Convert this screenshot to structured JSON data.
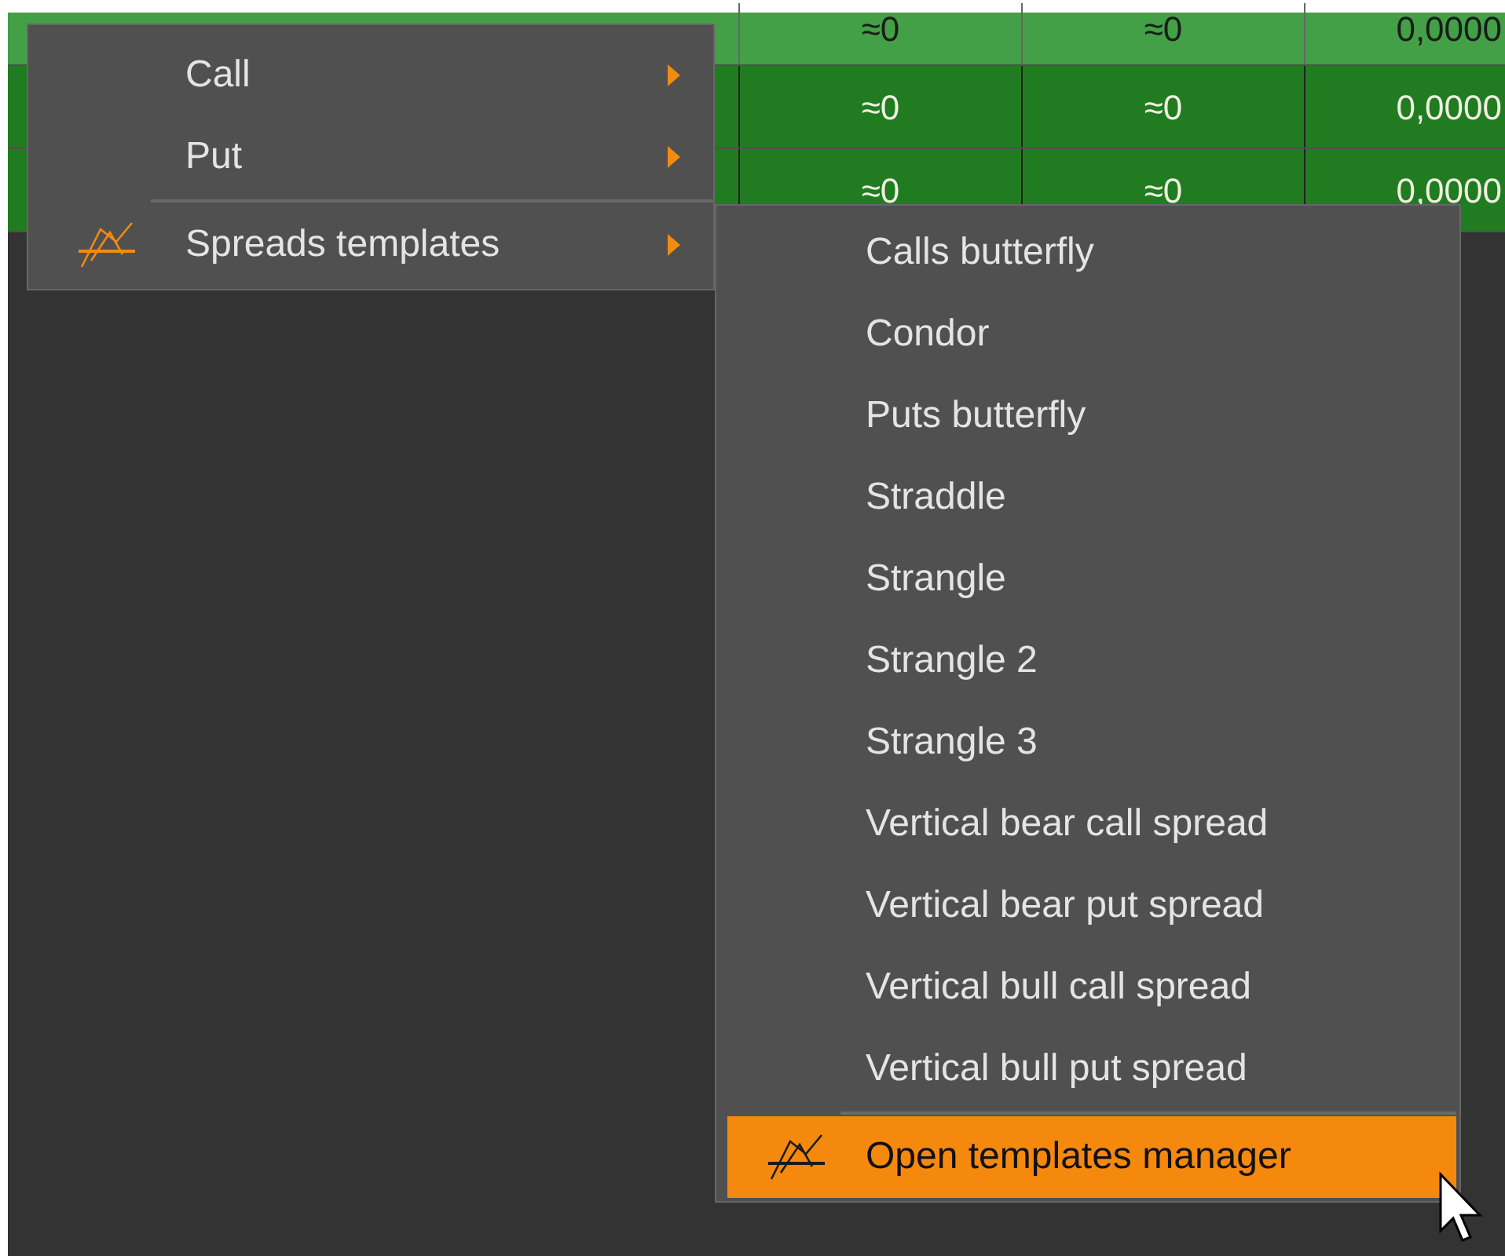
{
  "table": {
    "rows": [
      {
        "color": "#43a047",
        "cells": [
          "≈0",
          "≈0",
          "0,0000"
        ]
      },
      {
        "color": "#217c21",
        "cells": [
          "≈0",
          "≈0",
          "0,0000"
        ]
      },
      {
        "color": "#217c21",
        "cells": [
          "≈0",
          "≈0",
          "0,0000"
        ]
      }
    ]
  },
  "context_menu": {
    "items": [
      {
        "kind": "submenu",
        "label": "Call",
        "icon": false,
        "selected": false
      },
      {
        "kind": "submenu",
        "label": "Put",
        "icon": false,
        "selected": false
      },
      {
        "kind": "separator"
      },
      {
        "kind": "submenu",
        "label": "Spreads templates",
        "icon": true,
        "selected": false
      }
    ]
  },
  "submenu": {
    "items": [
      {
        "kind": "action",
        "label": "Calls butterfly",
        "icon": false,
        "selected": false
      },
      {
        "kind": "action",
        "label": "Condor",
        "icon": false,
        "selected": false
      },
      {
        "kind": "action",
        "label": "Puts butterfly",
        "icon": false,
        "selected": false
      },
      {
        "kind": "action",
        "label": "Straddle",
        "icon": false,
        "selected": false
      },
      {
        "kind": "action",
        "label": "Strangle",
        "icon": false,
        "selected": false
      },
      {
        "kind": "action",
        "label": "Strangle 2",
        "icon": false,
        "selected": false
      },
      {
        "kind": "action",
        "label": "Strangle 3",
        "icon": false,
        "selected": false
      },
      {
        "kind": "action",
        "label": "Vertical bear call spread",
        "icon": false,
        "selected": false
      },
      {
        "kind": "action",
        "label": "Vertical bear put spread",
        "icon": false,
        "selected": false
      },
      {
        "kind": "action",
        "label": "Vertical bull call spread",
        "icon": false,
        "selected": false
      },
      {
        "kind": "action",
        "label": "Vertical bull put spread",
        "icon": false,
        "selected": false
      },
      {
        "kind": "separator"
      },
      {
        "kind": "action",
        "label": "Open templates manager",
        "icon": true,
        "selected": true
      }
    ]
  }
}
